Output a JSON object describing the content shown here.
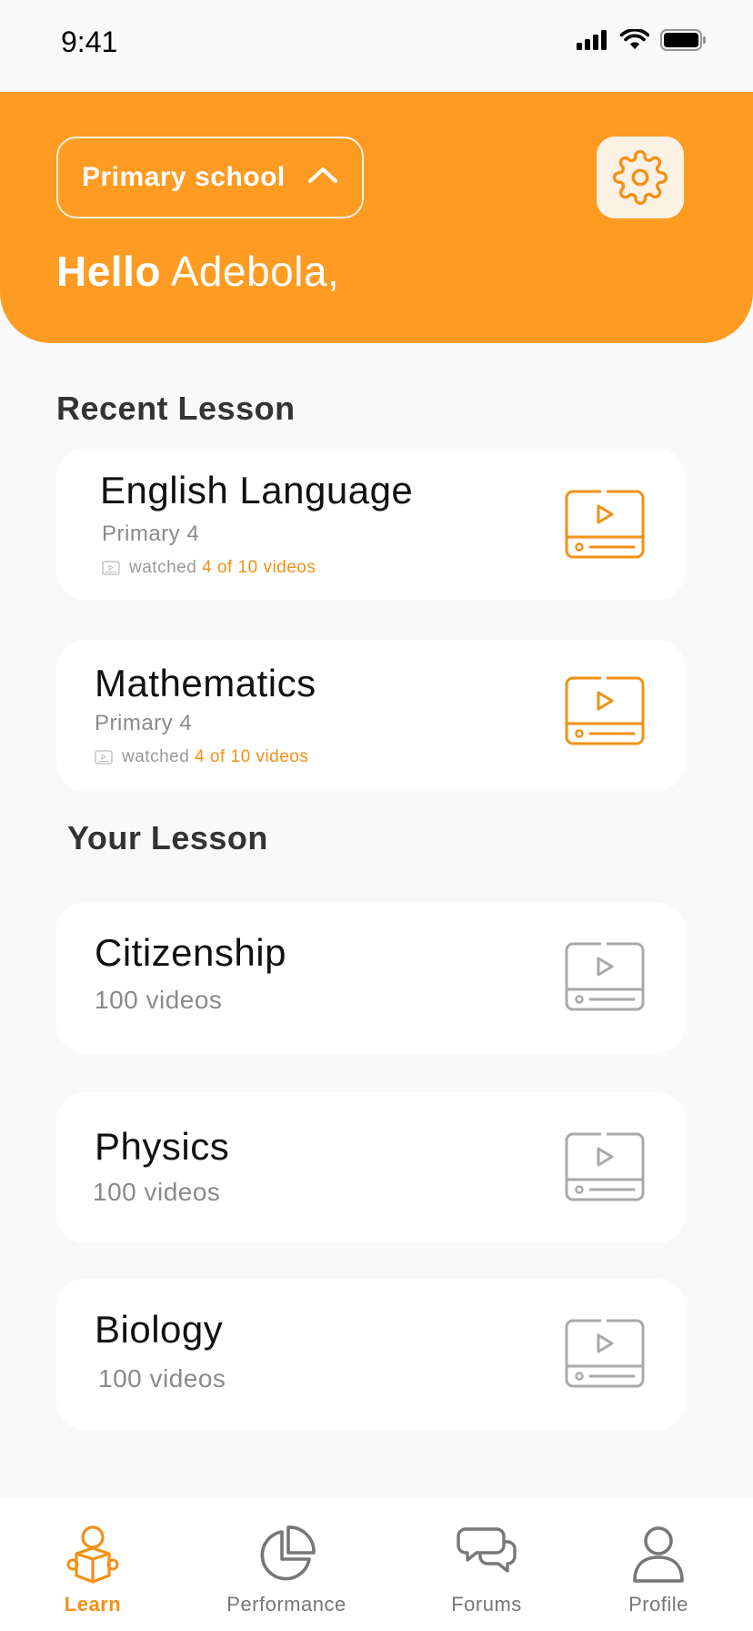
{
  "status": {
    "time": "9:41"
  },
  "header": {
    "school_select": "Primary school",
    "greeting_bold": "Hello",
    "greeting_name": "Adebola,"
  },
  "recent": {
    "title": "Recent Lesson",
    "items": [
      {
        "title": "English Language",
        "level": "Primary 4",
        "watched_label": "watched",
        "progress": "4 of 10 videos"
      },
      {
        "title": "Mathematics",
        "level": "Primary 4",
        "watched_label": "watched",
        "progress": "4 of 10 videos"
      }
    ]
  },
  "yours": {
    "title": "Your Lesson",
    "items": [
      {
        "title": "Citizenship",
        "count": "100 videos"
      },
      {
        "title": "Physics",
        "count": "100 videos"
      },
      {
        "title": "Biology",
        "count": "100 videos"
      }
    ]
  },
  "nav": {
    "items": [
      {
        "label": "Learn",
        "icon": "learn-icon",
        "active": true
      },
      {
        "label": "Performance",
        "icon": "pie-chart-icon",
        "active": false
      },
      {
        "label": "Forums",
        "icon": "chat-icon",
        "active": false
      },
      {
        "label": "Profile",
        "icon": "user-icon",
        "active": false
      }
    ]
  },
  "colors": {
    "accent": "#fd9b22",
    "accent_text": "#f39016",
    "muted": "#a9a9a9"
  }
}
